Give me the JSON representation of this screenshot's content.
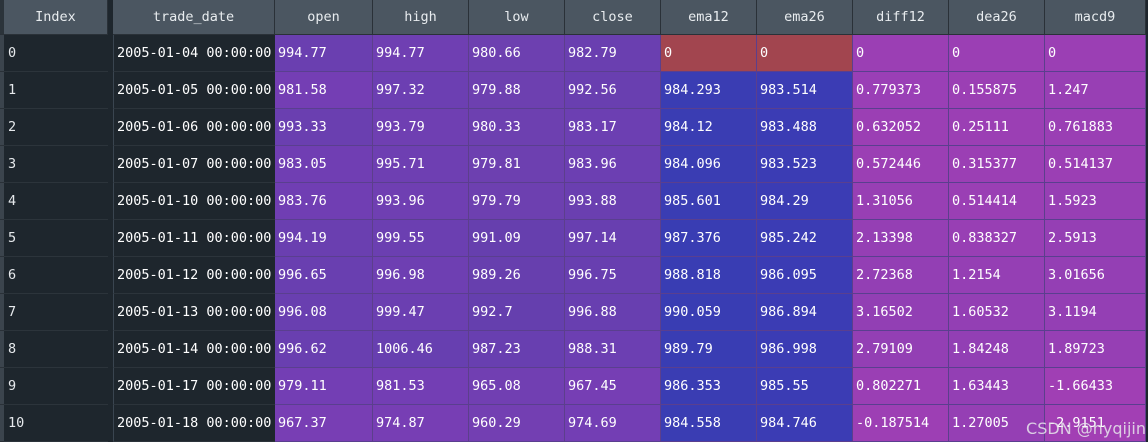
{
  "columns": {
    "index": "Index",
    "trade_date": "trade_date",
    "open": "open",
    "high": "high",
    "low": "low",
    "close": "close",
    "ema12": "ema12",
    "ema26": "ema26",
    "diff12": "diff12",
    "dea26": "dea26",
    "macd9": "macd9"
  },
  "rows": [
    {
      "index": "0",
      "trade_date": "2005-01-04 00:00:00",
      "open": "994.77",
      "high": "994.77",
      "low": "980.66",
      "close": "982.79",
      "ema12": "0",
      "ema26": "0",
      "diff12": "0",
      "dea26": "0",
      "macd9": "0"
    },
    {
      "index": "1",
      "trade_date": "2005-01-05 00:00:00",
      "open": "981.58",
      "high": "997.32",
      "low": "979.88",
      "close": "992.56",
      "ema12": "984.293",
      "ema26": "983.514",
      "diff12": "0.779373",
      "dea26": "0.155875",
      "macd9": "1.247"
    },
    {
      "index": "2",
      "trade_date": "2005-01-06 00:00:00",
      "open": "993.33",
      "high": "993.79",
      "low": "980.33",
      "close": "983.17",
      "ema12": "984.12",
      "ema26": "983.488",
      "diff12": "0.632052",
      "dea26": "0.25111",
      "macd9": "0.761883"
    },
    {
      "index": "3",
      "trade_date": "2005-01-07 00:00:00",
      "open": "983.05",
      "high": "995.71",
      "low": "979.81",
      "close": "983.96",
      "ema12": "984.096",
      "ema26": "983.523",
      "diff12": "0.572446",
      "dea26": "0.315377",
      "macd9": "0.514137"
    },
    {
      "index": "4",
      "trade_date": "2005-01-10 00:00:00",
      "open": "983.76",
      "high": "993.96",
      "low": "979.79",
      "close": "993.88",
      "ema12": "985.601",
      "ema26": "984.29",
      "diff12": "1.31056",
      "dea26": "0.514414",
      "macd9": "1.5923"
    },
    {
      "index": "5",
      "trade_date": "2005-01-11 00:00:00",
      "open": "994.19",
      "high": "999.55",
      "low": "991.09",
      "close": "997.14",
      "ema12": "987.376",
      "ema26": "985.242",
      "diff12": "2.13398",
      "dea26": "0.838327",
      "macd9": "2.5913"
    },
    {
      "index": "6",
      "trade_date": "2005-01-12 00:00:00",
      "open": "996.65",
      "high": "996.98",
      "low": "989.26",
      "close": "996.75",
      "ema12": "988.818",
      "ema26": "986.095",
      "diff12": "2.72368",
      "dea26": "1.2154",
      "macd9": "3.01656"
    },
    {
      "index": "7",
      "trade_date": "2005-01-13 00:00:00",
      "open": "996.08",
      "high": "999.47",
      "low": "992.7",
      "close": "996.88",
      "ema12": "990.059",
      "ema26": "986.894",
      "diff12": "3.16502",
      "dea26": "1.60532",
      "macd9": "3.1194"
    },
    {
      "index": "8",
      "trade_date": "2005-01-14 00:00:00",
      "open": "996.62",
      "high": "1006.46",
      "low": "987.23",
      "close": "988.31",
      "ema12": "989.79",
      "ema26": "986.998",
      "diff12": "2.79109",
      "dea26": "1.84248",
      "macd9": "1.89723"
    },
    {
      "index": "9",
      "trade_date": "2005-01-17 00:00:00",
      "open": "979.11",
      "high": "981.53",
      "low": "965.08",
      "close": "967.45",
      "ema12": "986.353",
      "ema26": "985.55",
      "diff12": "0.802271",
      "dea26": "1.63443",
      "macd9": "-1.66433"
    },
    {
      "index": "10",
      "trade_date": "2005-01-18 00:00:00",
      "open": "967.37",
      "high": "974.87",
      "low": "960.29",
      "close": "974.69",
      "ema12": "984.558",
      "ema26": "984.746",
      "diff12": "-0.187514",
      "dea26": "1.27005",
      "macd9": "-2.9151"
    }
  ],
  "cell_colors": [
    {
      "open": "#6a3fb0",
      "high": "#6f3fb2",
      "low": "#6d40b0",
      "close": "#6a3fb0",
      "ema12": "#a2454f",
      "ema26": "#a2454f",
      "diff12": "#9b3fb4",
      "dea26": "#9b3fb4",
      "macd9": "#9b3fb4"
    },
    {
      "open": "#743eb4",
      "high": "#6c3fb2",
      "low": "#6d40b0",
      "close": "#693fb0",
      "ema12": "#3a3db3",
      "ema26": "#3b3cb4",
      "diff12": "#9a3fb6",
      "dea26": "#9b3fb4",
      "macd9": "#983fb4"
    },
    {
      "open": "#6a3fb0",
      "high": "#6f3fb2",
      "low": "#6d40b0",
      "close": "#6c3fb2",
      "ema12": "#3a3db3",
      "ema26": "#3b3cb4",
      "diff12": "#9b3fb4",
      "dea26": "#9b3fb4",
      "macd9": "#9a3fb4"
    },
    {
      "open": "#703eb3",
      "high": "#6e3fb2",
      "low": "#6d40b0",
      "close": "#6c3fb2",
      "ema12": "#3a3db3",
      "ema26": "#3b3cb4",
      "diff12": "#9b3fb4",
      "dea26": "#9b3fb4",
      "macd9": "#9b3fb4"
    },
    {
      "open": "#703eb3",
      "high": "#6f3fb2",
      "low": "#6d40b0",
      "close": "#6a3fb0",
      "ema12": "#3a3db3",
      "ema26": "#3b3cb4",
      "diff12": "#983fb4",
      "dea26": "#9a3fb4",
      "macd9": "#973fb4"
    },
    {
      "open": "#6a3fb0",
      "high": "#6b3fb1",
      "low": "#663fae",
      "close": "#683fb0",
      "ema12": "#393db3",
      "ema26": "#3b3cb4",
      "diff12": "#953fb4",
      "dea26": "#983fb4",
      "macd9": "#953fb4"
    },
    {
      "open": "#693fb0",
      "high": "#6e3fb2",
      "low": "#673fae",
      "close": "#683fb0",
      "ema12": "#393db3",
      "ema26": "#3b3cb4",
      "diff12": "#933fb4",
      "dea26": "#953fb4",
      "macd9": "#943fb4"
    },
    {
      "open": "#693fb0",
      "high": "#6b3fb1",
      "low": "#653fae",
      "close": "#683fb0",
      "ema12": "#393db3",
      "ema26": "#3b3cb4",
      "diff12": "#923fb4",
      "dea26": "#933fb4",
      "macd9": "#943fb4"
    },
    {
      "open": "#693fb0",
      "high": "#673fb0",
      "low": "#683fb0",
      "close": "#6c3fb2",
      "ema12": "#393db3",
      "ema26": "#3b3cb4",
      "diff12": "#933fb4",
      "dea26": "#923fb4",
      "macd9": "#963fb4"
    },
    {
      "open": "#733eb4",
      "high": "#733eb4",
      "low": "#713fb2",
      "close": "#763eb4",
      "ema12": "#3a3db3",
      "ema26": "#3b3cb4",
      "diff12": "#9a3fb4",
      "dea26": "#933fb4",
      "macd9": "#a03fb4"
    },
    {
      "open": "#783eb4",
      "high": "#773eb4",
      "low": "#733fb2",
      "close": "#733eb4",
      "ema12": "#3a3db3",
      "ema26": "#3b3cb4",
      "diff12": "#9d3fb4",
      "dea26": "#953fb4",
      "macd9": "#a23fb4"
    }
  ],
  "watermark": "CSDN @hyqijin"
}
